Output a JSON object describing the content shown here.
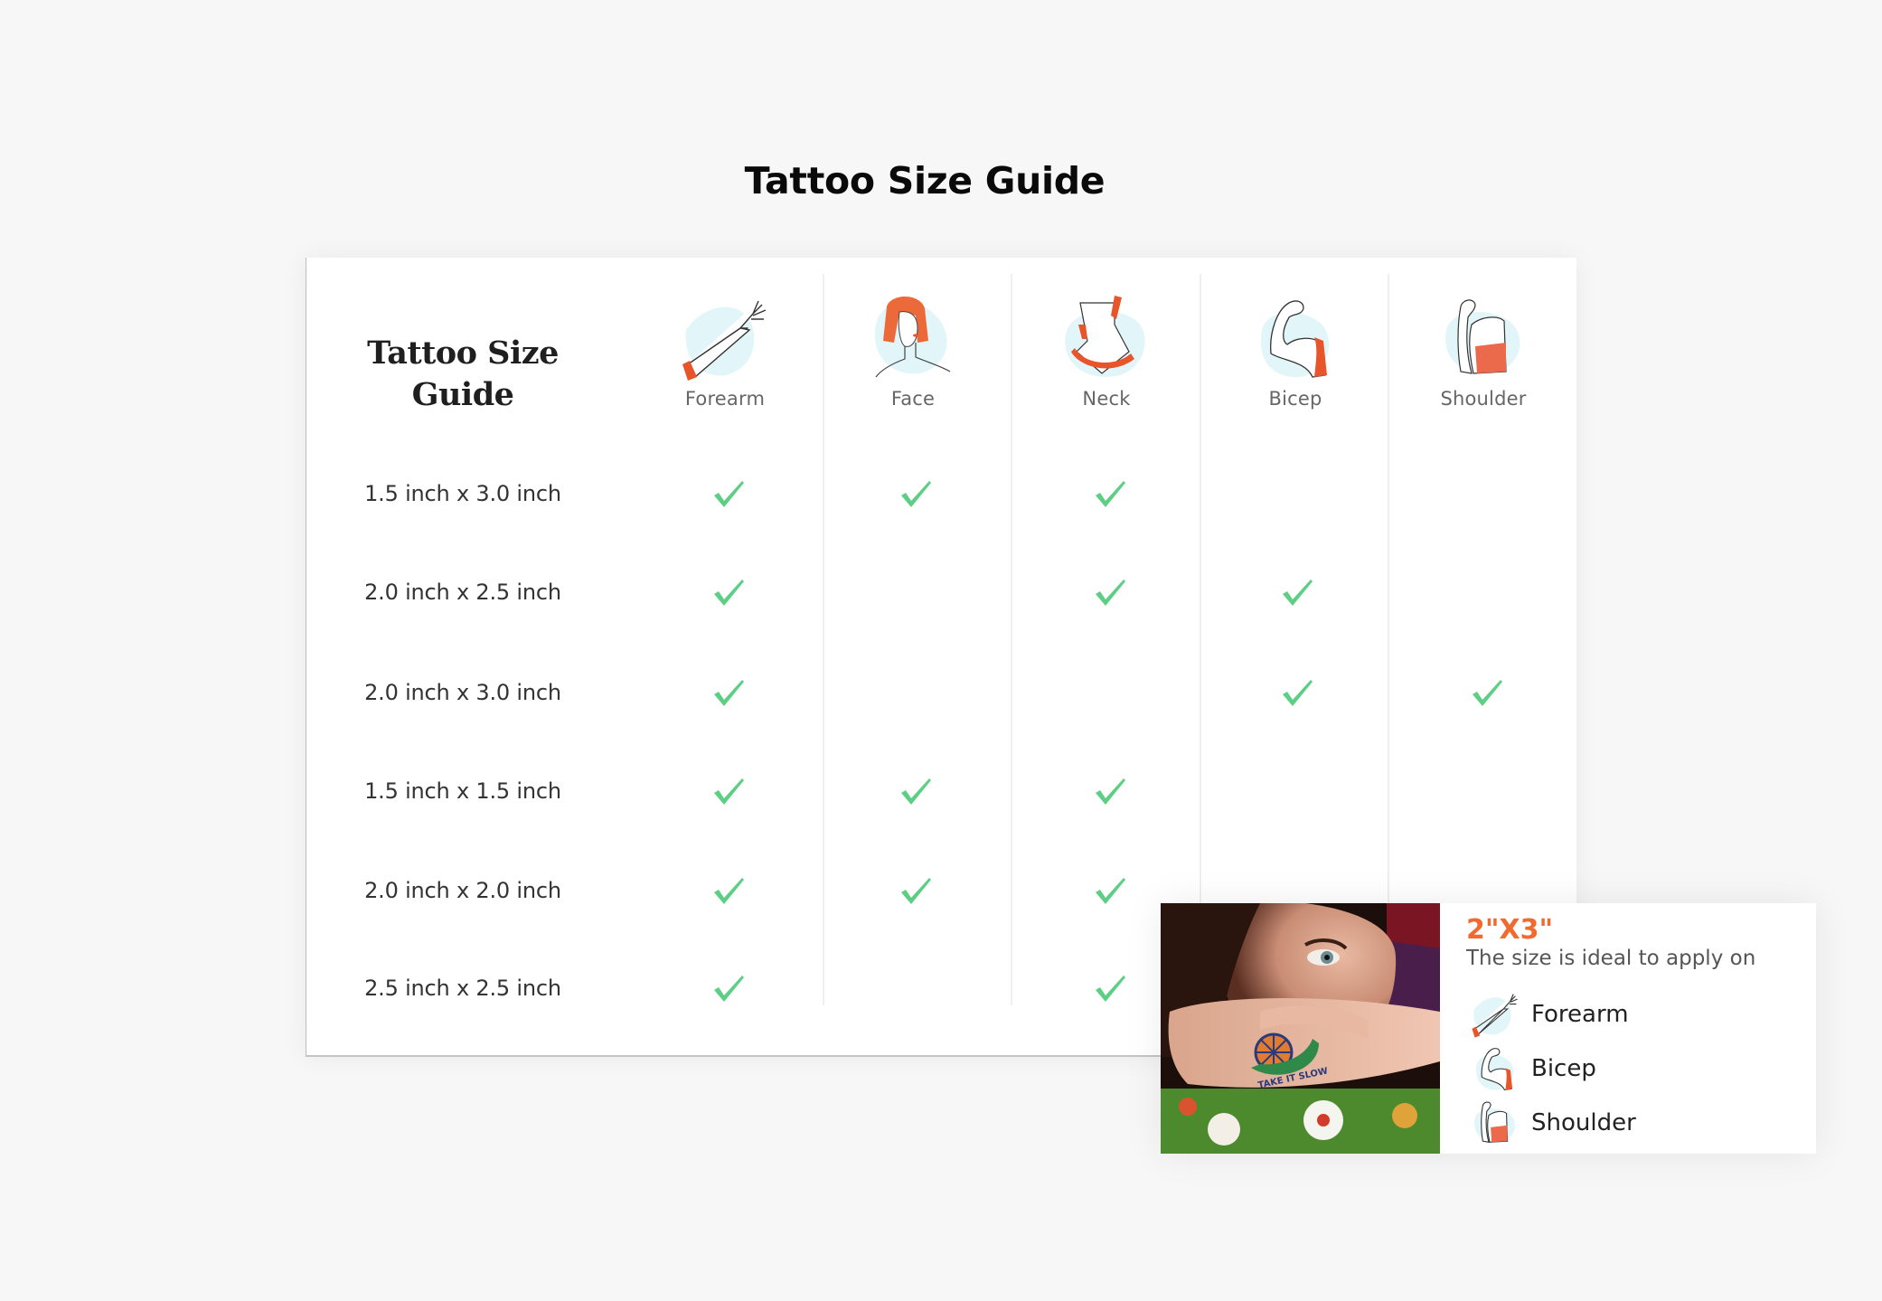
{
  "page": {
    "title": "Tattoo Size Guide",
    "background_color": "#f7f7f7"
  },
  "table": {
    "corner_title_line1": "Tattoo Size",
    "corner_title_line2": "Guide",
    "check_color": "#5ccf85",
    "columns": [
      {
        "label": "Forearm",
        "icon": "forearm-icon"
      },
      {
        "label": "Face",
        "icon": "face-icon"
      },
      {
        "label": "Neck",
        "icon": "neck-icon"
      },
      {
        "label": "Bicep",
        "icon": "bicep-icon"
      },
      {
        "label": "Shoulder",
        "icon": "shoulder-icon"
      }
    ],
    "rows": [
      {
        "size": "1.5 inch x 3.0 inch",
        "fits": [
          true,
          true,
          true,
          false,
          false
        ]
      },
      {
        "size": "2.0 inch x 2.5 inch",
        "fits": [
          true,
          false,
          true,
          true,
          false
        ]
      },
      {
        "size": "2.0 inch x 3.0 inch",
        "fits": [
          true,
          false,
          false,
          true,
          true
        ]
      },
      {
        "size": "1.5 inch x 1.5 inch",
        "fits": [
          true,
          true,
          true,
          false,
          false
        ]
      },
      {
        "size": "2.0 inch x 2.0 inch",
        "fits": [
          true,
          true,
          true,
          false,
          false
        ]
      },
      {
        "size": "2.5 inch x 2.5 inch",
        "fits": [
          true,
          false,
          true,
          false,
          false
        ]
      }
    ]
  },
  "popup": {
    "size_label": "2\"X3\"",
    "accent_color": "#f26a2e",
    "subtitle": "The size is ideal to apply on",
    "photo_caption_tattoo_text": "TAKE IT SLOW",
    "items": [
      {
        "label": "Forearm",
        "icon": "forearm-icon"
      },
      {
        "label": "Bicep",
        "icon": "bicep-icon"
      },
      {
        "label": "Shoulder",
        "icon": "shoulder-icon"
      }
    ]
  }
}
